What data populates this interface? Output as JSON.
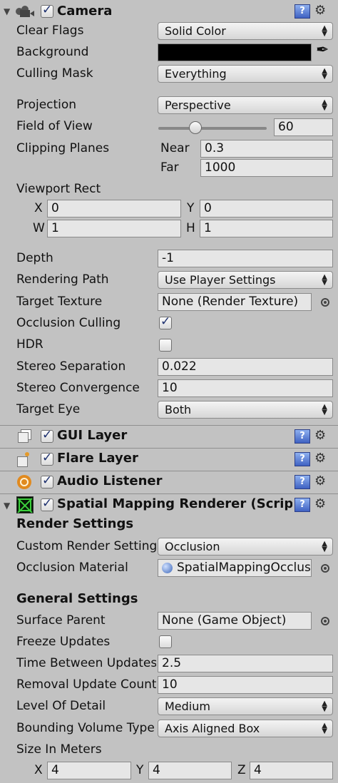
{
  "camera": {
    "title": "Camera",
    "enabled": true,
    "clear_flags": {
      "label": "Clear Flags",
      "value": "Solid Color"
    },
    "background": {
      "label": "Background",
      "color": "#000000"
    },
    "culling_mask": {
      "label": "Culling Mask",
      "value": "Everything"
    },
    "projection": {
      "label": "Projection",
      "value": "Perspective"
    },
    "field_of_view": {
      "label": "Field of View",
      "value": "60"
    },
    "clipping_planes": {
      "label": "Clipping Planes",
      "near_label": "Near",
      "near": "0.3",
      "far_label": "Far",
      "far": "1000"
    },
    "viewport_rect": {
      "label": "Viewport Rect",
      "x_label": "X",
      "x": "0",
      "y_label": "Y",
      "y": "0",
      "w_label": "W",
      "w": "1",
      "h_label": "H",
      "h": "1"
    },
    "depth": {
      "label": "Depth",
      "value": "-1"
    },
    "rendering_path": {
      "label": "Rendering Path",
      "value": "Use Player Settings"
    },
    "target_texture": {
      "label": "Target Texture",
      "value": "None (Render Texture)"
    },
    "occlusion_culling": {
      "label": "Occlusion Culling",
      "checked": true
    },
    "hdr": {
      "label": "HDR",
      "checked": false
    },
    "stereo_separation": {
      "label": "Stereo Separation",
      "value": "0.022"
    },
    "stereo_convergence": {
      "label": "Stereo Convergence",
      "value": "10"
    },
    "target_eye": {
      "label": "Target Eye",
      "value": "Both"
    }
  },
  "components": {
    "gui_layer": {
      "title": "GUI Layer",
      "enabled": true
    },
    "flare_layer": {
      "title": "Flare Layer",
      "enabled": true
    },
    "audio_listener": {
      "title": "Audio Listener",
      "enabled": true
    }
  },
  "spatial": {
    "title": "Spatial Mapping Renderer (Script)",
    "enabled": true,
    "render_settings": "Render Settings",
    "custom_render": {
      "label": "Custom Render Setting",
      "value": "Occlusion"
    },
    "occlusion_material": {
      "label": "Occlusion Material",
      "value": "SpatialMappingOcclusion"
    },
    "general_settings": "General Settings",
    "surface_parent": {
      "label": "Surface Parent",
      "value": "None (Game Object)"
    },
    "freeze_updates": {
      "label": "Freeze Updates",
      "checked": false
    },
    "time_between": {
      "label": "Time Between Updates",
      "value": "2.5"
    },
    "removal_update": {
      "label": "Removal Update Count",
      "value": "10"
    },
    "level_of_detail": {
      "label": "Level Of Detail",
      "value": "Medium"
    },
    "bounding_volume": {
      "label": "Bounding Volume Type",
      "value": "Axis Aligned Box"
    },
    "size_in_meters": {
      "label": "Size In Meters",
      "x_label": "X",
      "x": "4",
      "y_label": "Y",
      "y": "4",
      "z_label": "Z",
      "z": "4"
    }
  },
  "icons": {
    "help": "?",
    "gear": "⚙",
    "dropdown_arrow": "▲▼",
    "check": "✓"
  }
}
